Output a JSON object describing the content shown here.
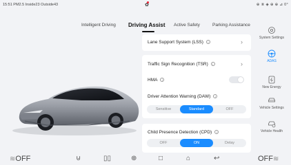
{
  "status": {
    "left": "15:51  PM2.5 Inside23 Outside43",
    "right": "⊕ ⑧ ◈ ⊕ ⊕  ⊿ 0°"
  },
  "tabs": [
    {
      "label": "Intelligent Driving",
      "active": false
    },
    {
      "label": "Driving Assist",
      "active": true
    },
    {
      "label": "Active Safety",
      "active": false
    },
    {
      "label": "Parking Assistance",
      "active": false
    }
  ],
  "settings": {
    "lss": {
      "label": "Lane Support System (LSS)"
    },
    "tsr": {
      "label": "Traffic Sign Recognition (TSR)"
    },
    "hma": {
      "label": "HMA",
      "state": "off"
    },
    "daw": {
      "label": "Driver Attention Warning (DAW)",
      "options": [
        "Sensitive",
        "Standard",
        "OFF"
      ],
      "selected": "Standard"
    },
    "cpd": {
      "label": "Child Presence Detection (CPD)",
      "options": [
        "OFF",
        "ON",
        "Delay"
      ],
      "selected": "ON"
    }
  },
  "sidebar": {
    "items": [
      {
        "label": "System Settings",
        "icon": "settings-icon",
        "active": false
      },
      {
        "label": "ADAS",
        "icon": "steering-wheel-icon",
        "active": true
      },
      {
        "label": "New Energy",
        "icon": "battery-icon",
        "active": false
      },
      {
        "label": "Vehicle Settings",
        "icon": "car-icon",
        "active": false
      },
      {
        "label": "Vehicle Health",
        "icon": "car-health-icon",
        "active": false
      }
    ]
  },
  "bottom": {
    "left_fan": "OFF",
    "right_fan": "OFF"
  },
  "colors": {
    "accent": "#1a8cff",
    "background": "#f2f3f6",
    "card": "#ffffff"
  }
}
